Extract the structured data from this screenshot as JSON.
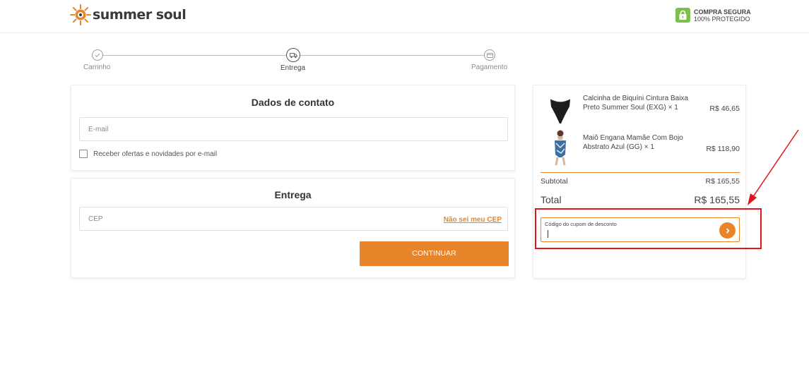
{
  "header": {
    "logo_text": "summer soul",
    "secure_line1": "COMPRA SEGURA",
    "secure_line2": "100% PROTEGIDO"
  },
  "stepper": {
    "steps": [
      {
        "label": "Carrinho",
        "icon": "check-icon",
        "state": "done"
      },
      {
        "label": "Entrega",
        "icon": "truck-icon",
        "state": "active"
      },
      {
        "label": "Pagamento",
        "icon": "card-icon",
        "state": "pending"
      }
    ]
  },
  "contact": {
    "title": "Dados de contato",
    "email_placeholder": "E-mail",
    "newsletter_label": "Receber ofertas e novidades por e-mail",
    "newsletter_checked": false
  },
  "delivery": {
    "title": "Entrega",
    "cep_placeholder": "CEP",
    "cep_link": "Não sei meu CEP",
    "continue_label": "CONTINUAR"
  },
  "summary": {
    "items": [
      {
        "name": "Calcinha de Biquíni Cintura Baixa Preto Summer Soul (EXG) × 1",
        "price": "R$ 46,65"
      },
      {
        "name": "Maiô Engana Mamãe Com Bojo Abstrato Azul (GG) × 1",
        "price": "R$ 118,90"
      }
    ],
    "subtotal_label": "Subtotal",
    "subtotal_value": "R$ 165,55",
    "total_label": "Total",
    "total_value": "R$ 165,55",
    "coupon_label": "Código do cupom de desconto",
    "coupon_value": ""
  },
  "colors": {
    "accent": "#e8842a",
    "secure_green": "#7cc04b",
    "annotation_red": "#e0141f"
  }
}
